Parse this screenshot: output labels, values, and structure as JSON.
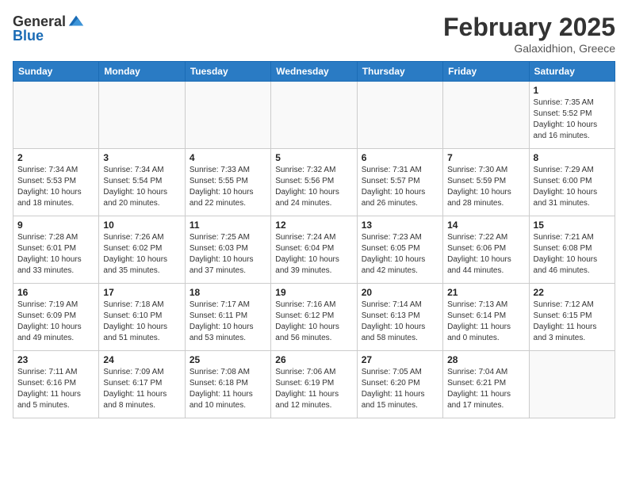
{
  "header": {
    "logo_general": "General",
    "logo_blue": "Blue",
    "month_title": "February 2025",
    "location": "Galaxidhion, Greece"
  },
  "calendar": {
    "days_of_week": [
      "Sunday",
      "Monday",
      "Tuesday",
      "Wednesday",
      "Thursday",
      "Friday",
      "Saturday"
    ],
    "weeks": [
      [
        {
          "day": "",
          "info": ""
        },
        {
          "day": "",
          "info": ""
        },
        {
          "day": "",
          "info": ""
        },
        {
          "day": "",
          "info": ""
        },
        {
          "day": "",
          "info": ""
        },
        {
          "day": "",
          "info": ""
        },
        {
          "day": "1",
          "info": "Sunrise: 7:35 AM\nSunset: 5:52 PM\nDaylight: 10 hours and 16 minutes."
        }
      ],
      [
        {
          "day": "2",
          "info": "Sunrise: 7:34 AM\nSunset: 5:53 PM\nDaylight: 10 hours and 18 minutes."
        },
        {
          "day": "3",
          "info": "Sunrise: 7:34 AM\nSunset: 5:54 PM\nDaylight: 10 hours and 20 minutes."
        },
        {
          "day": "4",
          "info": "Sunrise: 7:33 AM\nSunset: 5:55 PM\nDaylight: 10 hours and 22 minutes."
        },
        {
          "day": "5",
          "info": "Sunrise: 7:32 AM\nSunset: 5:56 PM\nDaylight: 10 hours and 24 minutes."
        },
        {
          "day": "6",
          "info": "Sunrise: 7:31 AM\nSunset: 5:57 PM\nDaylight: 10 hours and 26 minutes."
        },
        {
          "day": "7",
          "info": "Sunrise: 7:30 AM\nSunset: 5:59 PM\nDaylight: 10 hours and 28 minutes."
        },
        {
          "day": "8",
          "info": "Sunrise: 7:29 AM\nSunset: 6:00 PM\nDaylight: 10 hours and 31 minutes."
        }
      ],
      [
        {
          "day": "9",
          "info": "Sunrise: 7:28 AM\nSunset: 6:01 PM\nDaylight: 10 hours and 33 minutes."
        },
        {
          "day": "10",
          "info": "Sunrise: 7:26 AM\nSunset: 6:02 PM\nDaylight: 10 hours and 35 minutes."
        },
        {
          "day": "11",
          "info": "Sunrise: 7:25 AM\nSunset: 6:03 PM\nDaylight: 10 hours and 37 minutes."
        },
        {
          "day": "12",
          "info": "Sunrise: 7:24 AM\nSunset: 6:04 PM\nDaylight: 10 hours and 39 minutes."
        },
        {
          "day": "13",
          "info": "Sunrise: 7:23 AM\nSunset: 6:05 PM\nDaylight: 10 hours and 42 minutes."
        },
        {
          "day": "14",
          "info": "Sunrise: 7:22 AM\nSunset: 6:06 PM\nDaylight: 10 hours and 44 minutes."
        },
        {
          "day": "15",
          "info": "Sunrise: 7:21 AM\nSunset: 6:08 PM\nDaylight: 10 hours and 46 minutes."
        }
      ],
      [
        {
          "day": "16",
          "info": "Sunrise: 7:19 AM\nSunset: 6:09 PM\nDaylight: 10 hours and 49 minutes."
        },
        {
          "day": "17",
          "info": "Sunrise: 7:18 AM\nSunset: 6:10 PM\nDaylight: 10 hours and 51 minutes."
        },
        {
          "day": "18",
          "info": "Sunrise: 7:17 AM\nSunset: 6:11 PM\nDaylight: 10 hours and 53 minutes."
        },
        {
          "day": "19",
          "info": "Sunrise: 7:16 AM\nSunset: 6:12 PM\nDaylight: 10 hours and 56 minutes."
        },
        {
          "day": "20",
          "info": "Sunrise: 7:14 AM\nSunset: 6:13 PM\nDaylight: 10 hours and 58 minutes."
        },
        {
          "day": "21",
          "info": "Sunrise: 7:13 AM\nSunset: 6:14 PM\nDaylight: 11 hours and 0 minutes."
        },
        {
          "day": "22",
          "info": "Sunrise: 7:12 AM\nSunset: 6:15 PM\nDaylight: 11 hours and 3 minutes."
        }
      ],
      [
        {
          "day": "23",
          "info": "Sunrise: 7:11 AM\nSunset: 6:16 PM\nDaylight: 11 hours and 5 minutes."
        },
        {
          "day": "24",
          "info": "Sunrise: 7:09 AM\nSunset: 6:17 PM\nDaylight: 11 hours and 8 minutes."
        },
        {
          "day": "25",
          "info": "Sunrise: 7:08 AM\nSunset: 6:18 PM\nDaylight: 11 hours and 10 minutes."
        },
        {
          "day": "26",
          "info": "Sunrise: 7:06 AM\nSunset: 6:19 PM\nDaylight: 11 hours and 12 minutes."
        },
        {
          "day": "27",
          "info": "Sunrise: 7:05 AM\nSunset: 6:20 PM\nDaylight: 11 hours and 15 minutes."
        },
        {
          "day": "28",
          "info": "Sunrise: 7:04 AM\nSunset: 6:21 PM\nDaylight: 11 hours and 17 minutes."
        },
        {
          "day": "",
          "info": ""
        }
      ]
    ]
  }
}
